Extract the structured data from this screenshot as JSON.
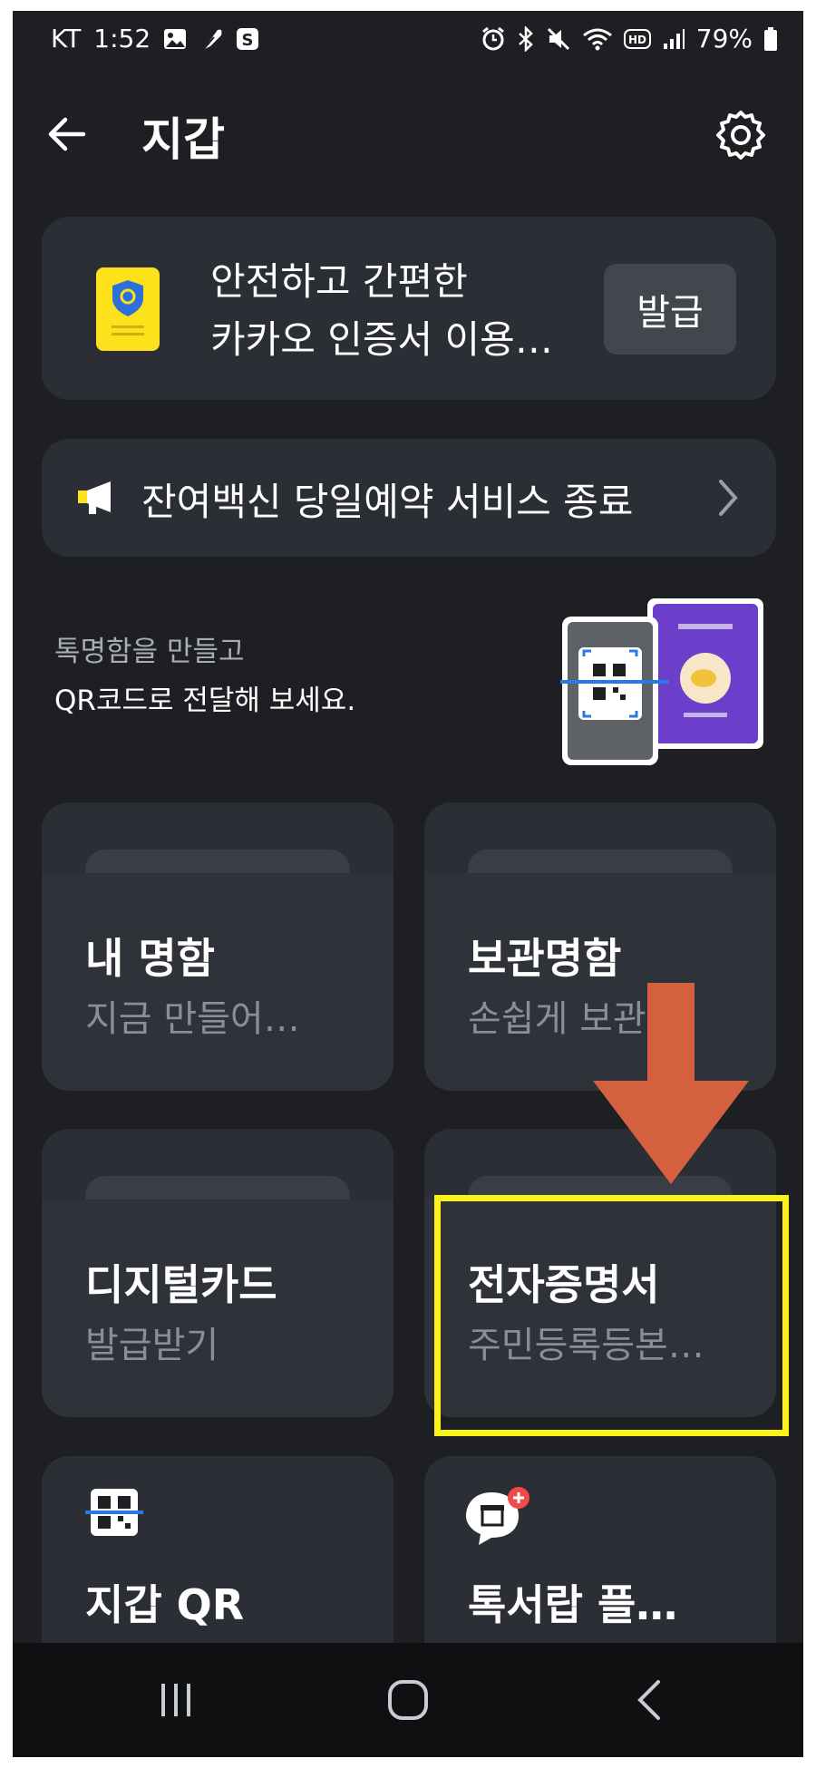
{
  "status_bar": {
    "carrier": "KT",
    "time": "1:52",
    "battery": "79%",
    "icons": [
      "gallery-icon",
      "feather-icon",
      "s-icon",
      "alarm-icon",
      "bluetooth-icon",
      "mute-icon",
      "wifi-icon",
      "hd-icon",
      "signal-icon",
      "battery-icon"
    ]
  },
  "header": {
    "title": "지갑"
  },
  "cert_card": {
    "line1": "안전하고 간편한",
    "line2": "카카오 인증서 이용…",
    "button_label": "발급"
  },
  "notice": {
    "text": "잔여백신 당일예약 서비스 종료"
  },
  "promo": {
    "line1": "톡명함을 만들고",
    "line2": "QR코드로 전달해 보세요."
  },
  "tiles": [
    {
      "title": "내 명함",
      "subtitle": "지금 만들어…"
    },
    {
      "title": "보관명함",
      "subtitle": "손쉽게 보관…"
    },
    {
      "title": "디지털카드",
      "subtitle": "발급받기"
    },
    {
      "title": "전자증명서",
      "subtitle": "주민등록등본…"
    },
    {
      "title": "지갑 QR"
    },
    {
      "title": "톡서랍 플…"
    }
  ],
  "colors": {
    "background": "#1d1f23",
    "card": "#2b2e34",
    "highlight": "#fbf21a",
    "arrow": "#d4603f",
    "cert_yellow": "#fde21b"
  }
}
